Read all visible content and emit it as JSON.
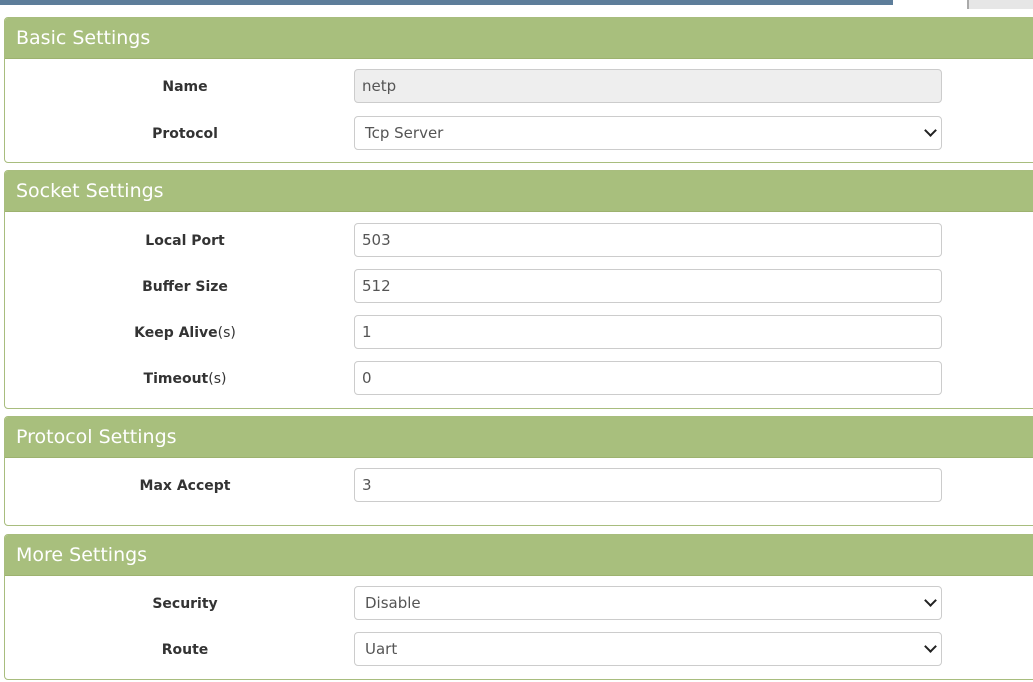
{
  "panels": {
    "basic": {
      "title": "Basic Settings",
      "name_label": "Name",
      "name_value": "netp",
      "protocol_label": "Protocol",
      "protocol_value": "Tcp Server"
    },
    "socket": {
      "title": "Socket Settings",
      "local_port_label": "Local Port",
      "local_port_value": "503",
      "buffer_size_label": "Buffer Size",
      "buffer_size_value": "512",
      "keep_alive_label": "Keep Alive",
      "keep_alive_unit": "(s)",
      "keep_alive_value": "1",
      "timeout_label": "Timeout",
      "timeout_unit": "(s)",
      "timeout_value": "0"
    },
    "protocol": {
      "title": "Protocol Settings",
      "max_accept_label": "Max Accept",
      "max_accept_value": "3"
    },
    "more": {
      "title": "More Settings",
      "security_label": "Security",
      "security_value": "Disable",
      "route_label": "Route",
      "route_value": "Uart"
    }
  },
  "colors": {
    "panel_header": "#a8bf7d",
    "panel_border": "#a8bd7e",
    "top_bar": "#5d7d9a"
  }
}
